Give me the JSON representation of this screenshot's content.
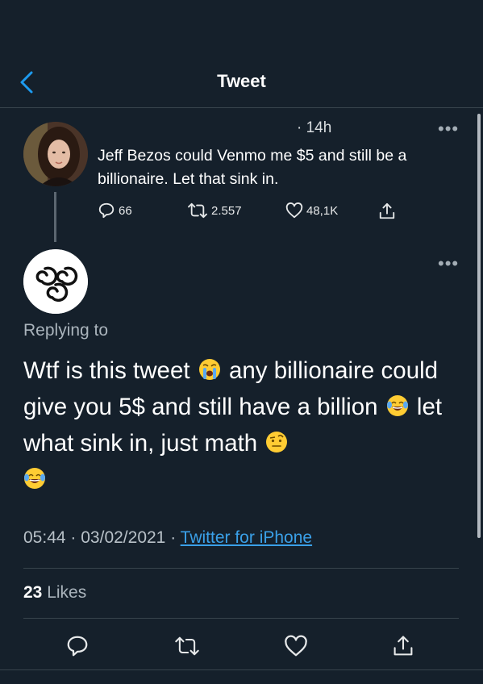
{
  "header": {
    "title": "Tweet"
  },
  "parent_tweet": {
    "time": "· 14h",
    "text": "Jeff Bezos could Venmo me $5 and still be a billionaire. Let that sink in.",
    "replies": "66",
    "retweets": "2.557",
    "likes": "48,1K"
  },
  "reply_tweet": {
    "replying_label": "Replying to",
    "text_parts": [
      "Wtf is this tweet",
      "any billionaire could give you 5$ and still have a billion",
      "let what sink in, just math"
    ],
    "emojis": [
      "loudly-crying-face",
      "face-with-tears-of-joy",
      "face-with-raised-eyebrow",
      "face-with-tears-of-joy"
    ],
    "time": "05:44",
    "date": "03/02/2021",
    "separator": "·",
    "source": "Twitter for iPhone",
    "likes_count": "23",
    "likes_label": "Likes"
  },
  "colors": {
    "background": "#15202b",
    "divider": "#38444d",
    "link": "#3aa0e8",
    "secondary_text": "#aab4bc"
  }
}
